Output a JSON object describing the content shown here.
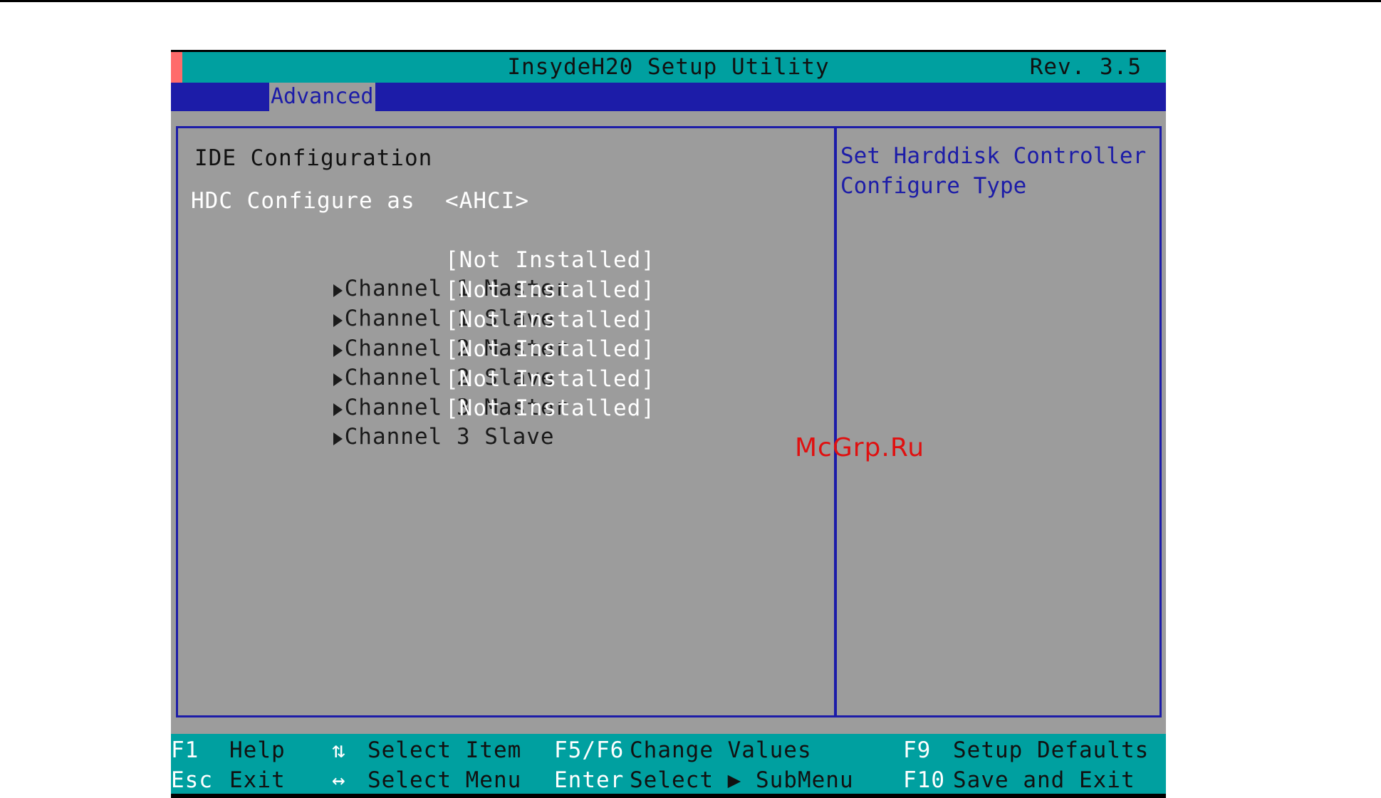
{
  "title": "InsydeH20 Setup Utility",
  "revision": "Rev. 3.5",
  "menu": {
    "active_tab": "Advanced"
  },
  "main": {
    "heading": "IDE Configuration",
    "hdc": {
      "label": "HDC Configure as",
      "value": "<AHCI>"
    },
    "channels": [
      {
        "label": "Channel 1 Master",
        "value": "[Not Installed]"
      },
      {
        "label": "Channel 1 Slave",
        "value": "[Not Installed]"
      },
      {
        "label": "Channel 2 Master",
        "value": "[Not Installed]"
      },
      {
        "label": "Channel 2 Slave",
        "value": "[Not Installed]"
      },
      {
        "label": "Channel 3 Master",
        "value": "[Not Installed]"
      },
      {
        "label": "Channel 3 Slave",
        "value": "[Not Installed]"
      }
    ]
  },
  "help": {
    "text": "Set Harddisk Controller\nConfigure Type"
  },
  "watermark": "McGrp.Ru",
  "status": {
    "f1_key": "F1",
    "f1_desc": "Help",
    "esc_key": "Esc",
    "esc_desc": "Exit",
    "updown_icon": "⇅",
    "updown_desc": "Select Item",
    "leftright_icon": "↔",
    "leftright_desc": "Select Menu",
    "f5f6_key": "F5/F6",
    "f5f6_desc": "Change Values",
    "enter_key": "Enter",
    "enter_desc": "Select ▶ SubMenu",
    "f9_key": "F9",
    "f9_desc": "Setup Defaults",
    "f10_key": "F10",
    "f10_desc": "Save and Exit"
  },
  "colors": {
    "teal": "#00a0a0",
    "navy": "#1c1ca8",
    "gray": "#9c9c9c",
    "watermark_red": "#e01010"
  }
}
